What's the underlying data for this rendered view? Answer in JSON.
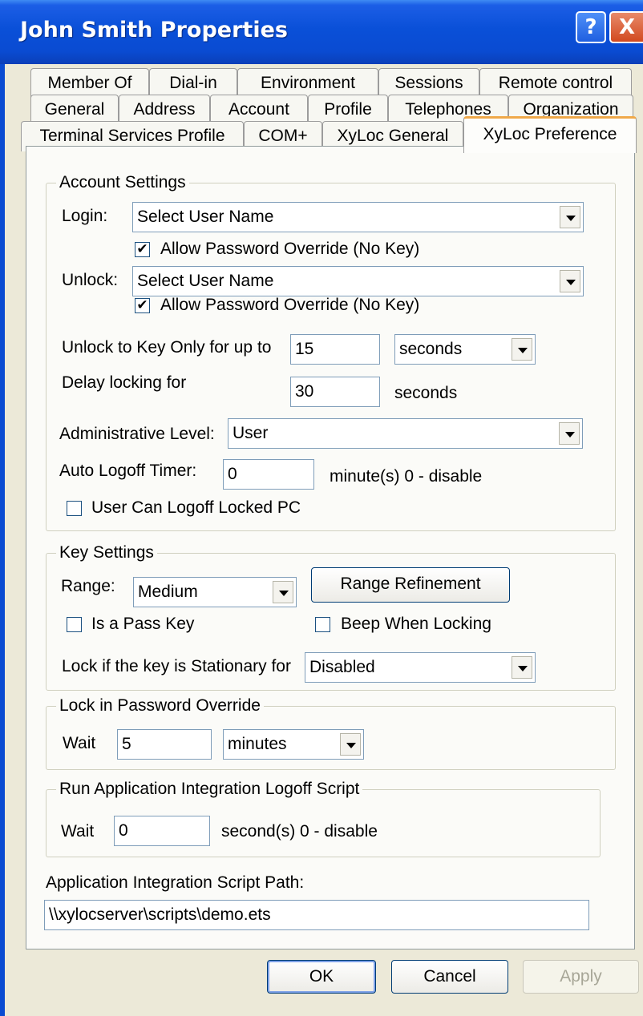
{
  "window": {
    "title": "John Smith Properties",
    "help_glyph": "?",
    "close_glyph": "X"
  },
  "tabs": {
    "row1": [
      "Member Of",
      "Dial-in",
      "Environment",
      "Sessions",
      "Remote control"
    ],
    "row2": [
      "General",
      "Address",
      "Account",
      "Profile",
      "Telephones",
      "Organization"
    ],
    "row3": [
      "Terminal Services Profile",
      "COM+",
      "XyLoc General",
      "XyLoc Preference"
    ]
  },
  "account_settings": {
    "legend": "Account Settings",
    "login_label": "Login:",
    "login_value": "Select User Name",
    "login_override": "Allow Password Override (No Key)",
    "unlock_label": "Unlock:",
    "unlock_value": "Select User Name",
    "unlock_override": "Allow Password Override (No Key)",
    "unlock_key_label": "Unlock to Key Only for up to",
    "unlock_key_value": "15",
    "unlock_key_unit": "seconds",
    "delay_label": "Delay locking for",
    "delay_value": "30",
    "delay_unit": "seconds",
    "admin_label": "Administrative Level:",
    "admin_value": "User",
    "logoff_label": "Auto Logoff Timer:",
    "logoff_value": "0",
    "logoff_hint": "minute(s)  0 - disable",
    "user_logoff_label": "User Can Logoff Locked PC",
    "check_mark": "✔"
  },
  "key_settings": {
    "legend": "Key Settings",
    "range_label": "Range:",
    "range_value": "Medium",
    "range_refinement": "Range Refinement",
    "pass_key_label": "Is a Pass Key",
    "beep_label": "Beep When Locking",
    "stationary_label": "Lock if the key is Stationary for",
    "stationary_value": "Disabled"
  },
  "password_override": {
    "legend": "Lock in Password Override",
    "wait_label": "Wait",
    "wait_value": "5",
    "wait_unit": "minutes"
  },
  "logoff_script": {
    "legend": "Run Application Integration Logoff Script",
    "wait_label": "Wait",
    "wait_value": "0",
    "wait_hint": "second(s) 0 - disable"
  },
  "script_path": {
    "label": "Application Integration Script Path:",
    "value": "\\\\xylocserver\\scripts\\demo.ets"
  },
  "buttons": {
    "ok": "OK",
    "cancel": "Cancel",
    "apply": "Apply"
  }
}
